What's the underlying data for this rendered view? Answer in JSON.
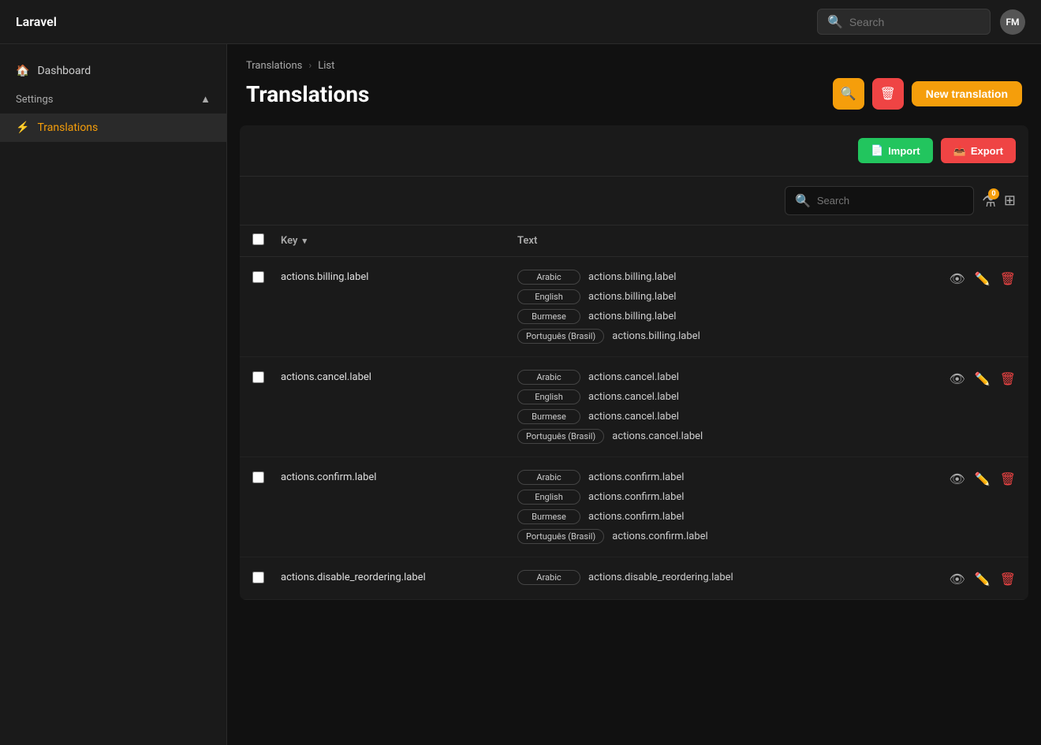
{
  "app": {
    "name": "Laravel",
    "user_initials": "FM"
  },
  "topnav": {
    "search_placeholder": "Search"
  },
  "sidebar": {
    "dashboard_label": "Dashboard",
    "settings_label": "Settings",
    "translations_label": "Translations"
  },
  "breadcrumb": {
    "parent": "Translations",
    "current": "List"
  },
  "page": {
    "title": "Translations"
  },
  "toolbar": {
    "search_icon": "🔍",
    "delete_icon": "🗑",
    "new_translation_label": "New translation"
  },
  "table_toolbar": {
    "import_label": "Import",
    "export_label": "Export",
    "search_placeholder": "Search",
    "filter_badge": "0"
  },
  "columns": {
    "key": "Key",
    "text": "Text"
  },
  "rows": [
    {
      "key": "actions.billing.label",
      "translations": [
        {
          "lang": "Arabic",
          "value": "actions.billing.label"
        },
        {
          "lang": "English",
          "value": "actions.billing.label"
        },
        {
          "lang": "Burmese",
          "value": "actions.billing.label"
        },
        {
          "lang": "Português (Brasil)",
          "value": "actions.billing.label"
        }
      ]
    },
    {
      "key": "actions.cancel.label",
      "translations": [
        {
          "lang": "Arabic",
          "value": "actions.cancel.label"
        },
        {
          "lang": "English",
          "value": "actions.cancel.label"
        },
        {
          "lang": "Burmese",
          "value": "actions.cancel.label"
        },
        {
          "lang": "Português (Brasil)",
          "value": "actions.cancel.label"
        }
      ]
    },
    {
      "key": "actions.confirm.label",
      "translations": [
        {
          "lang": "Arabic",
          "value": "actions.confirm.label"
        },
        {
          "lang": "English",
          "value": "actions.confirm.label"
        },
        {
          "lang": "Burmese",
          "value": "actions.confirm.label"
        },
        {
          "lang": "Português (Brasil)",
          "value": "actions.confirm.label"
        }
      ]
    },
    {
      "key": "actions.disable_reordering.label",
      "translations": [
        {
          "lang": "Arabic",
          "value": "actions.disable_reordering.label"
        }
      ]
    }
  ]
}
